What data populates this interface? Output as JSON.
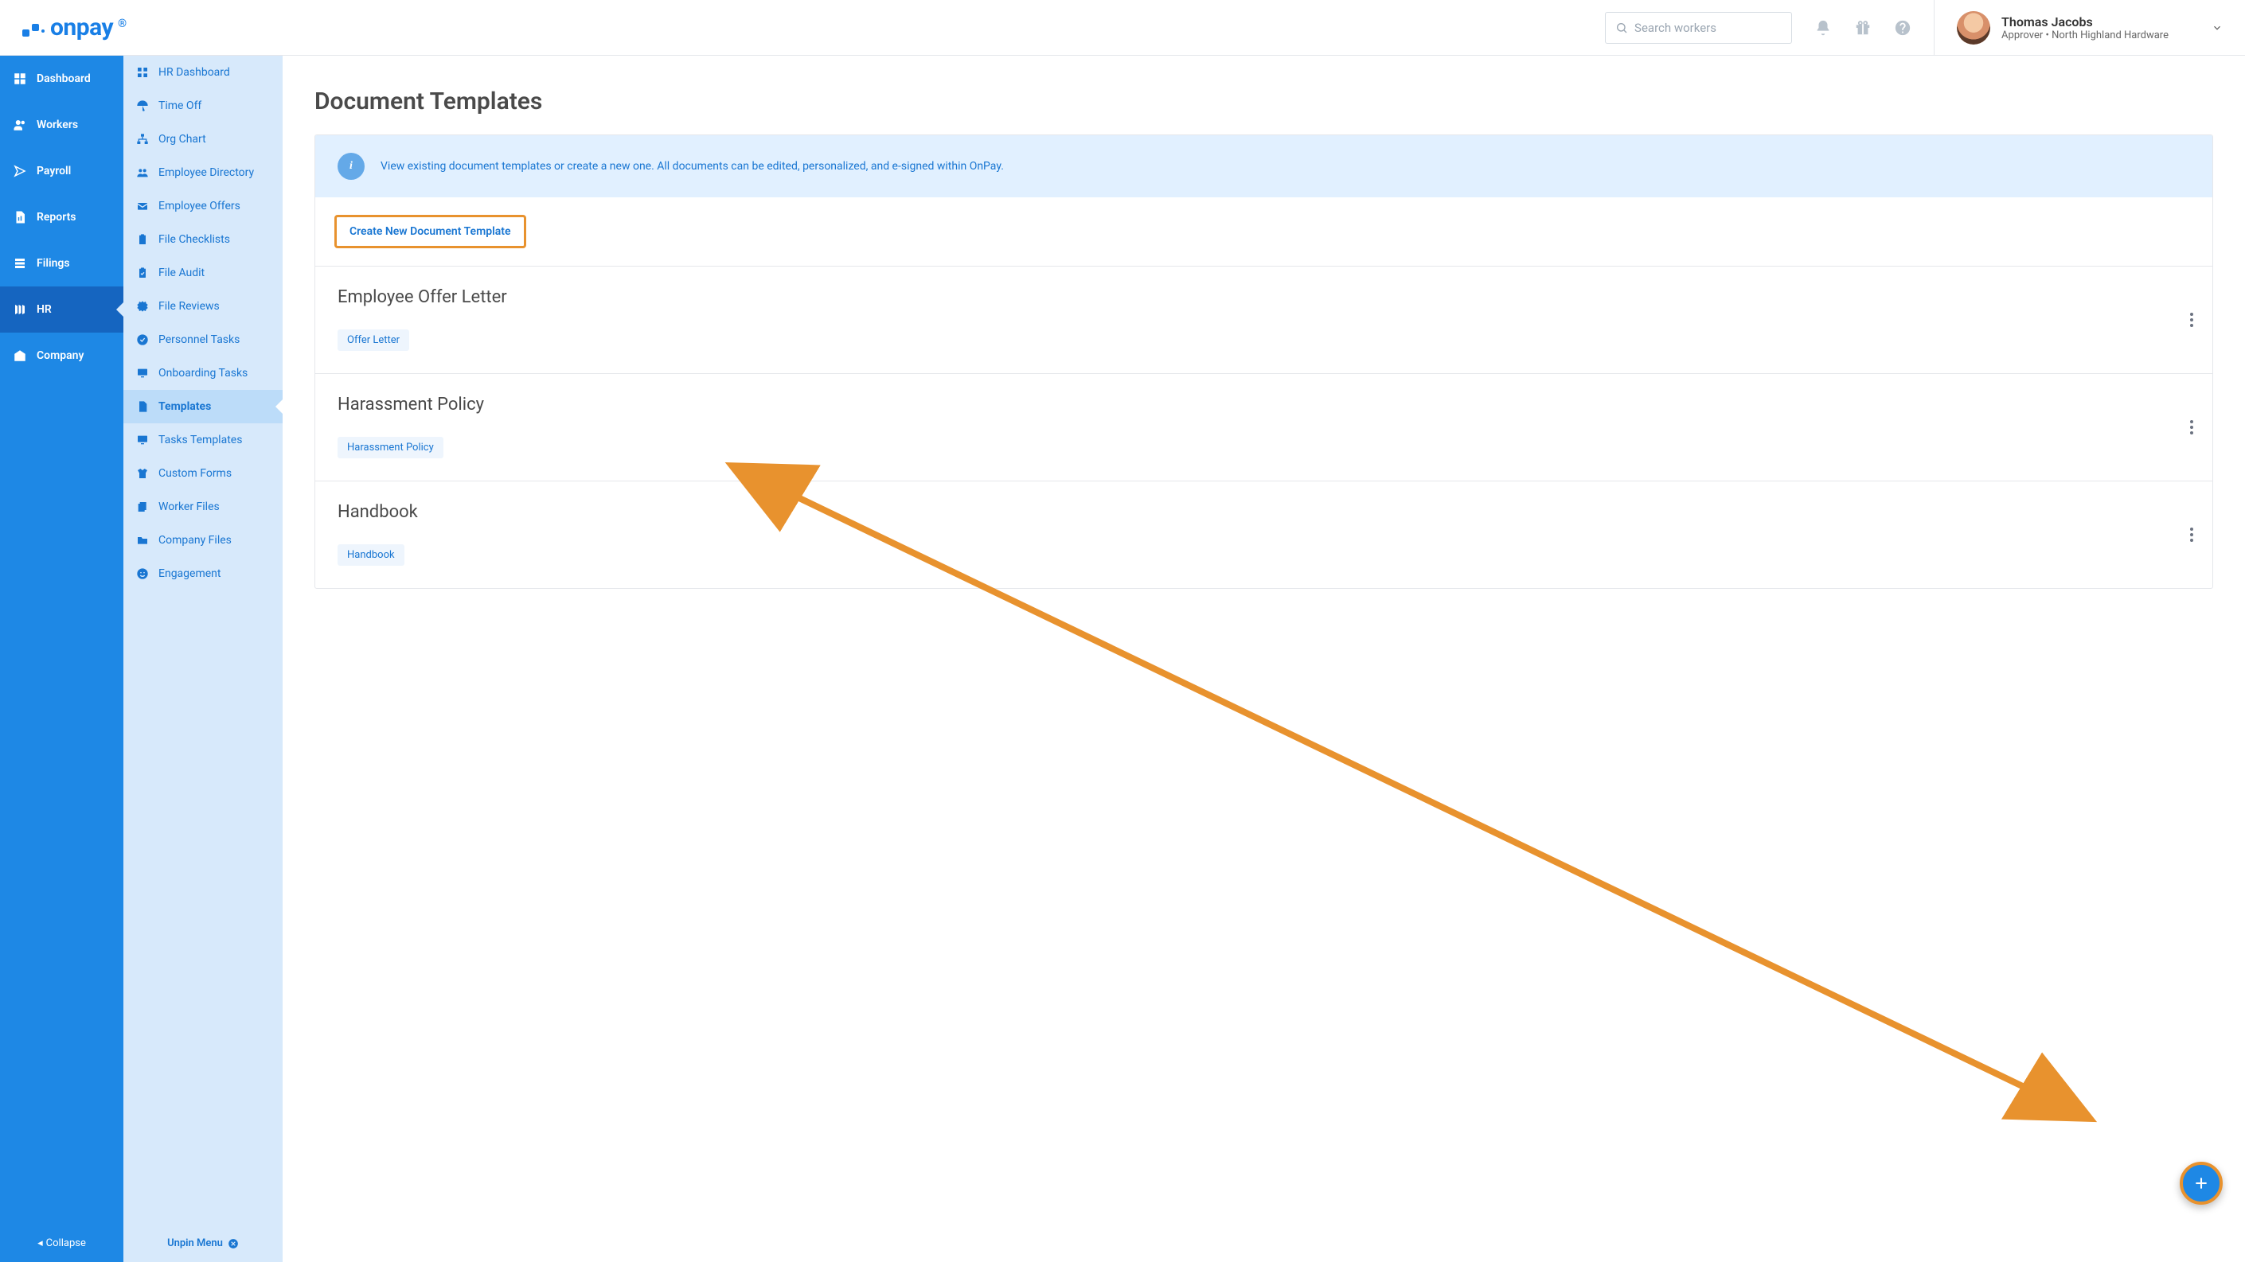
{
  "header": {
    "logo_text": "onpay",
    "search_placeholder": "Search workers",
    "user_name": "Thomas Jacobs",
    "user_role": "Approver",
    "user_company": "North Highland Hardware"
  },
  "sidebar_primary": {
    "items": [
      {
        "label": "Dashboard",
        "icon": "dashboard-icon"
      },
      {
        "label": "Workers",
        "icon": "workers-icon"
      },
      {
        "label": "Payroll",
        "icon": "payroll-icon"
      },
      {
        "label": "Reports",
        "icon": "reports-icon"
      },
      {
        "label": "Filings",
        "icon": "filings-icon"
      },
      {
        "label": "HR",
        "icon": "hr-icon",
        "active": true
      },
      {
        "label": "Company",
        "icon": "company-icon"
      }
    ],
    "collapse_label": "Collapse"
  },
  "sidebar_secondary": {
    "items": [
      {
        "label": "HR Dashboard",
        "icon": "grid-icon"
      },
      {
        "label": "Time Off",
        "icon": "umbrella-icon"
      },
      {
        "label": "Org Chart",
        "icon": "org-icon"
      },
      {
        "label": "Employee Directory",
        "icon": "people-icon"
      },
      {
        "label": "Employee Offers",
        "icon": "envelope-icon"
      },
      {
        "label": "File Checklists",
        "icon": "clipboard-icon"
      },
      {
        "label": "File Audit",
        "icon": "clipboard-check-icon"
      },
      {
        "label": "File Reviews",
        "icon": "badge-icon"
      },
      {
        "label": "Personnel Tasks",
        "icon": "check-circle-icon"
      },
      {
        "label": "Onboarding Tasks",
        "icon": "monitor-icon"
      },
      {
        "label": "Templates",
        "icon": "document-icon",
        "active": true
      },
      {
        "label": "Tasks Templates",
        "icon": "monitor-icon"
      },
      {
        "label": "Custom Forms",
        "icon": "shirt-icon"
      },
      {
        "label": "Worker Files",
        "icon": "files-icon"
      },
      {
        "label": "Company Files",
        "icon": "folder-icon"
      },
      {
        "label": "Engagement",
        "icon": "smile-icon"
      }
    ],
    "unpin_label": "Unpin Menu"
  },
  "main": {
    "page_title": "Document Templates",
    "info_text": "View existing document templates or create a new one. All documents can be edited, personalized, and e-signed within OnPay.",
    "create_button": "Create New Document Template",
    "templates": [
      {
        "title": "Employee Offer Letter",
        "tag": "Offer Letter"
      },
      {
        "title": "Harassment Policy",
        "tag": "Harassment Policy"
      },
      {
        "title": "Handbook",
        "tag": "Handbook"
      }
    ]
  }
}
